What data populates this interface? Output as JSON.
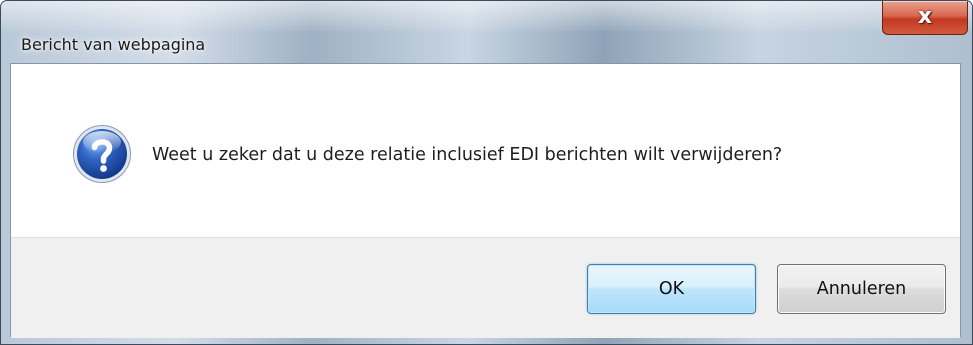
{
  "dialog": {
    "title": "Bericht van webpagina",
    "close_glyph": "x",
    "icon": "question-icon",
    "message": "Weet u zeker dat u deze relatie inclusief EDI berichten wilt verwijderen?",
    "buttons": {
      "ok_label": "OK",
      "cancel_label": "Annuleren"
    }
  },
  "colors": {
    "close_button": "#c2391f",
    "ok_border": "#3c7fb1",
    "icon_blue": "#1f4fa8",
    "footer_bg": "#f0f0f0"
  }
}
